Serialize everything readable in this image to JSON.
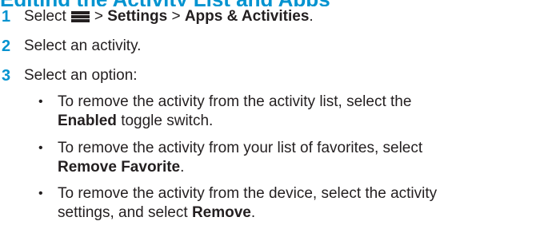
{
  "heading": "Editing the Activity List and Apps",
  "steps": [
    {
      "num": "1",
      "select": "Select",
      "sep1": ">",
      "settings": "Settings",
      "sep2": ">",
      "apps": "Apps & Activities",
      "end": ".",
      "icon": "menu-icon"
    },
    {
      "num": "2",
      "text": "Select an activity."
    },
    {
      "num": "3",
      "text": "Select an option:"
    }
  ],
  "options": [
    {
      "bullet": "•",
      "line1": "To remove the activity from the activity list, select the",
      "bold": "Enabled",
      "tail": "toggle switch."
    },
    {
      "bullet": "•",
      "line1": "To remove the activity from your list of favorites, select",
      "bold": "Remove Favorite",
      "tail": "."
    },
    {
      "bullet": "•",
      "line1": "To remove the activity from the device, select the activity",
      "line2": "settings, and select",
      "bold": "Remove",
      "tail": "."
    }
  ]
}
